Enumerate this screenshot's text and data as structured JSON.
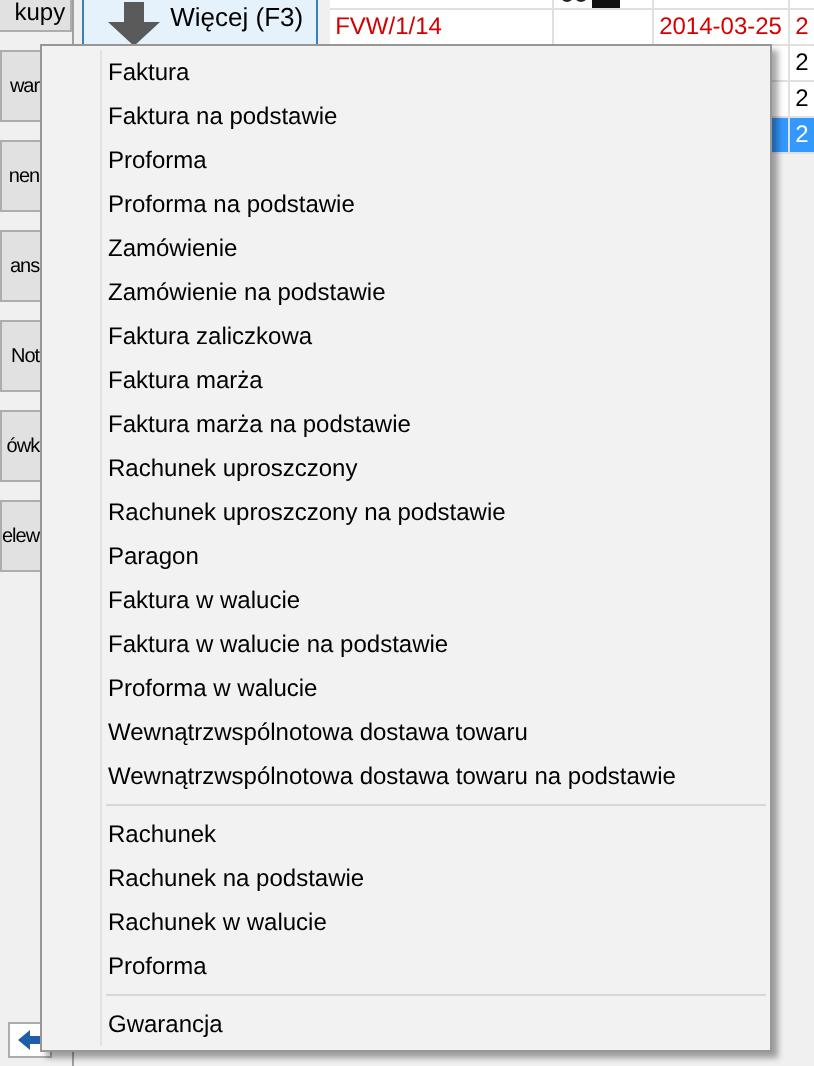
{
  "sidebar": {
    "buttons": [
      "kupy",
      "war",
      "nen",
      "ans",
      "Not",
      "ówk",
      "elew"
    ]
  },
  "toolbar": {
    "more_button": "Więcej (F3)"
  },
  "table": {
    "rows": [
      {
        "number": "FVW/1/14",
        "date": "2014-03-25",
        "column_4": "2",
        "red": true,
        "selected": false
      },
      {
        "number": "",
        "date": "",
        "column_4": "2",
        "red": false,
        "selected": false
      },
      {
        "number": "",
        "date": "",
        "column_4": "2",
        "red": false,
        "selected": false
      },
      {
        "number": "",
        "date": "",
        "column_4": "2",
        "red": false,
        "selected": true
      }
    ]
  },
  "menu": {
    "sections": [
      [
        "Faktura",
        "Faktura na podstawie",
        "Proforma",
        "Proforma na podstawie",
        "Zamówienie",
        "Zamówienie na podstawie",
        "Faktura zaliczkowa",
        "Faktura marża",
        "Faktura marża na podstawie",
        "Rachunek uproszczony",
        "Rachunek uproszczony na podstawie",
        "Paragon",
        "Faktura w walucie",
        "Faktura w walucie na podstawie",
        "Proforma w walucie",
        "Wewnątrzwspólnotowa dostawa towaru",
        "Wewnątrzwspólnotowa dostawa towaru na podstawie"
      ],
      [
        "Rachunek",
        "Rachunek na podstawie",
        "Rachunek w walucie",
        "Proforma"
      ],
      [
        "Gwarancja"
      ]
    ]
  }
}
